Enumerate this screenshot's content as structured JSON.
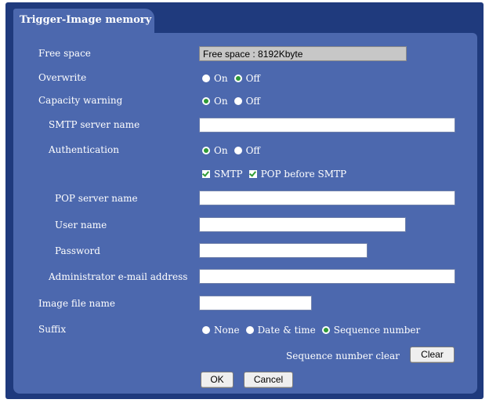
{
  "tab": {
    "title": "Trigger-Image memory"
  },
  "free_space": {
    "label": "Free space",
    "value": "Free space : 8192Kbyte"
  },
  "overwrite": {
    "label": "Overwrite",
    "on": "On",
    "off": "Off",
    "selected": "Off"
  },
  "capacity_warning": {
    "label": "Capacity warning",
    "on": "On",
    "off": "Off",
    "selected": "On"
  },
  "smtp_server_name": {
    "label": "SMTP server name",
    "value": ""
  },
  "authentication": {
    "label": "Authentication",
    "on": "On",
    "off": "Off",
    "selected": "On",
    "smtp": "SMTP",
    "smtp_checked": true,
    "pop": "POP before SMTP",
    "pop_checked": true
  },
  "pop_server_name": {
    "label": "POP server name",
    "value": ""
  },
  "user_name": {
    "label": "User name",
    "value": ""
  },
  "password": {
    "label": "Password",
    "value": ""
  },
  "admin_email": {
    "label": "Administrator e-mail address",
    "value": ""
  },
  "image_file_name": {
    "label": "Image file name",
    "value": ""
  },
  "suffix": {
    "label": "Suffix",
    "none": "None",
    "date_time": "Date & time",
    "sequence": "Sequence number",
    "selected": "Sequence number"
  },
  "sequence_clear": {
    "label": "Sequence number clear",
    "button": "Clear"
  },
  "buttons": {
    "ok": "OK",
    "cancel": "Cancel"
  }
}
